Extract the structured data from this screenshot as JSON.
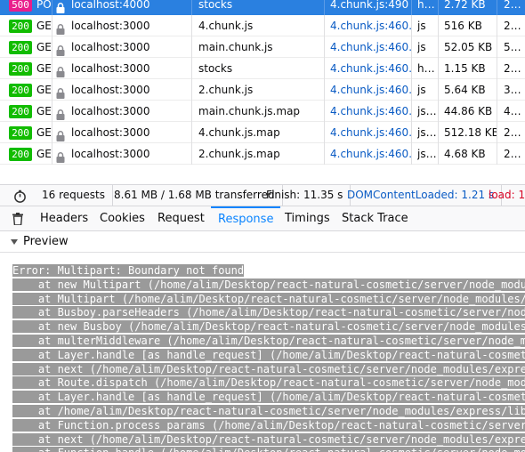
{
  "requests": [
    {
      "status": "500",
      "method": "POS",
      "domain": "localhost:4000",
      "file": "stocks",
      "cause": "4.chunk.js:490 …",
      "type": "h…",
      "size": "2.72 KB",
      "time": "2…",
      "selected": true
    },
    {
      "status": "200",
      "method": "GET",
      "domain": "localhost:3000",
      "file": "4.chunk.js",
      "cause": "4.chunk.js:460…",
      "type": "js",
      "size": "516 KB",
      "time": "2…"
    },
    {
      "status": "200",
      "method": "GET",
      "domain": "localhost:3000",
      "file": "main.chunk.js",
      "cause": "4.chunk.js:460…",
      "type": "js",
      "size": "52.05 KB",
      "time": "5…"
    },
    {
      "status": "200",
      "method": "GET",
      "domain": "localhost:3000",
      "file": "stocks",
      "cause": "4.chunk.js:460…",
      "type": "h…",
      "size": "1.15 KB",
      "time": "2…"
    },
    {
      "status": "200",
      "method": "GET",
      "domain": "localhost:3000",
      "file": "2.chunk.js",
      "cause": "4.chunk.js:460…",
      "type": "js",
      "size": "5.64 KB",
      "time": "3…"
    },
    {
      "status": "200",
      "method": "GET",
      "domain": "localhost:3000",
      "file": "main.chunk.js.map",
      "cause": "4.chunk.js:460…",
      "type": "js…",
      "size": "44.86 KB",
      "time": "4…"
    },
    {
      "status": "200",
      "method": "GET",
      "domain": "localhost:3000",
      "file": "4.chunk.js.map",
      "cause": "4.chunk.js:460…",
      "type": "js…",
      "size": "512.18 KB",
      "time": "2…"
    },
    {
      "status": "200",
      "method": "GET",
      "domain": "localhost:3000",
      "file": "2.chunk.js.map",
      "cause": "4.chunk.js:460…",
      "type": "js…",
      "size": "4.68 KB",
      "time": "2…"
    }
  ],
  "summary": {
    "requests": "16 requests",
    "transferred": "8.61 MB / 1.68 MB transferred",
    "finish": "Finish: 11.35 s",
    "dom_content_loaded": "DOMContentLoaded: 1.21 s",
    "load": "load: 1.3"
  },
  "tabs": [
    "Headers",
    "Cookies",
    "Request",
    "Response",
    "Timings",
    "Stack Trace"
  ],
  "active_tab": "Response",
  "preview_label": "Preview",
  "error_lines": [
    "Error: Multipart: Boundary not found",
    "    at new Multipart (/home/alim/Desktop/react-natural-cosmetic/server/node_modu",
    "    at Multipart (/home/alim/Desktop/react-natural-cosmetic/server/node_modules/",
    "    at Busboy.parseHeaders (/home/alim/Desktop/react-natural-cosmetic/server/nod",
    "    at new Busboy (/home/alim/Desktop/react-natural-cosmetic/server/node_modules",
    "    at multerMiddleware (/home/alim/Desktop/react-natural-cosmetic/server/node_m",
    "    at Layer.handle [as handle_request] (/home/alim/Desktop/react-natural-cosmet",
    "    at next (/home/alim/Desktop/react-natural-cosmetic/server/node_modules/expre",
    "    at Route.dispatch (/home/alim/Desktop/react-natural-cosmetic/server/node_mod",
    "    at Layer.handle [as handle_request] (/home/alim/Desktop/react-natural-cosmet",
    "    at /home/alim/Desktop/react-natural-cosmetic/server/node_modules/express/lib",
    "    at Function.process_params (/home/alim/Desktop/react-natural-cosmetic/server",
    "    at next (/home/alim/Desktop/react-natural-cosmetic/server/node_modules/expre",
    "    at Function.handle (/home/alim/Desktop/react-natural-cosmetic/server/node_mo"
  ],
  "colors": {
    "accent": "#0a84ff",
    "selected_row": "#2a80e0",
    "status_ok": "#12bc00",
    "status_error": "#e91e8c"
  },
  "icons": {
    "lock": "lock-icon",
    "stopwatch": "stopwatch-icon",
    "trash": "trash-icon",
    "twisty": "twisty-icon"
  }
}
